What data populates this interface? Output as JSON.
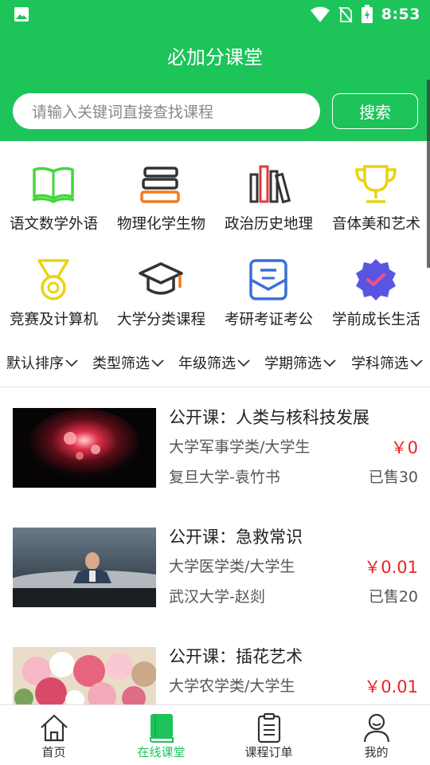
{
  "status_bar": {
    "time": "8:53"
  },
  "app": {
    "title": "必加分课堂"
  },
  "search": {
    "placeholder": "请输入关键词直接查找课程",
    "button_label": "搜索"
  },
  "categories": [
    {
      "label": "语文数学外语",
      "icon": "book-icon"
    },
    {
      "label": "物理化学生物",
      "icon": "books-stack-icon"
    },
    {
      "label": "政治历史地理",
      "icon": "bookshelf-icon"
    },
    {
      "label": "音体美和艺术",
      "icon": "trophy-icon"
    },
    {
      "label": "竞赛及计算机",
      "icon": "medal-icon"
    },
    {
      "label": "大学分类课程",
      "icon": "graduation-cap-icon"
    },
    {
      "label": "考研考证考公",
      "icon": "document-icon"
    },
    {
      "label": "学前成长生活",
      "icon": "badge-check-icon"
    }
  ],
  "filters": [
    "默认排序",
    "类型筛选",
    "年级筛选",
    "学期筛选",
    "学科筛选"
  ],
  "courses": [
    {
      "title": "公开课：人类与核科技发展",
      "category": "大学军事学类/大学生",
      "price": "￥0",
      "school": "复旦大学-袁竹书",
      "sold": "已售30"
    },
    {
      "title": "公开课：急救常识",
      "category": "大学医学类/大学生",
      "price": "￥0.01",
      "school": "武汉大学-赵剡",
      "sold": "已售20"
    },
    {
      "title": "公开课：插花艺术",
      "category": "大学农学类/大学生",
      "price": "￥0.01",
      "school": "",
      "sold": ""
    }
  ],
  "tabs": [
    {
      "label": "首页",
      "icon": "home-icon",
      "active": false
    },
    {
      "label": "在线课堂",
      "icon": "book-closed-icon",
      "active": true
    },
    {
      "label": "课程订单",
      "icon": "clipboard-icon",
      "active": false
    },
    {
      "label": "我的",
      "icon": "user-icon",
      "active": false
    }
  ],
  "colors": {
    "brand": "#1dc45a",
    "price": "#ef2222"
  }
}
